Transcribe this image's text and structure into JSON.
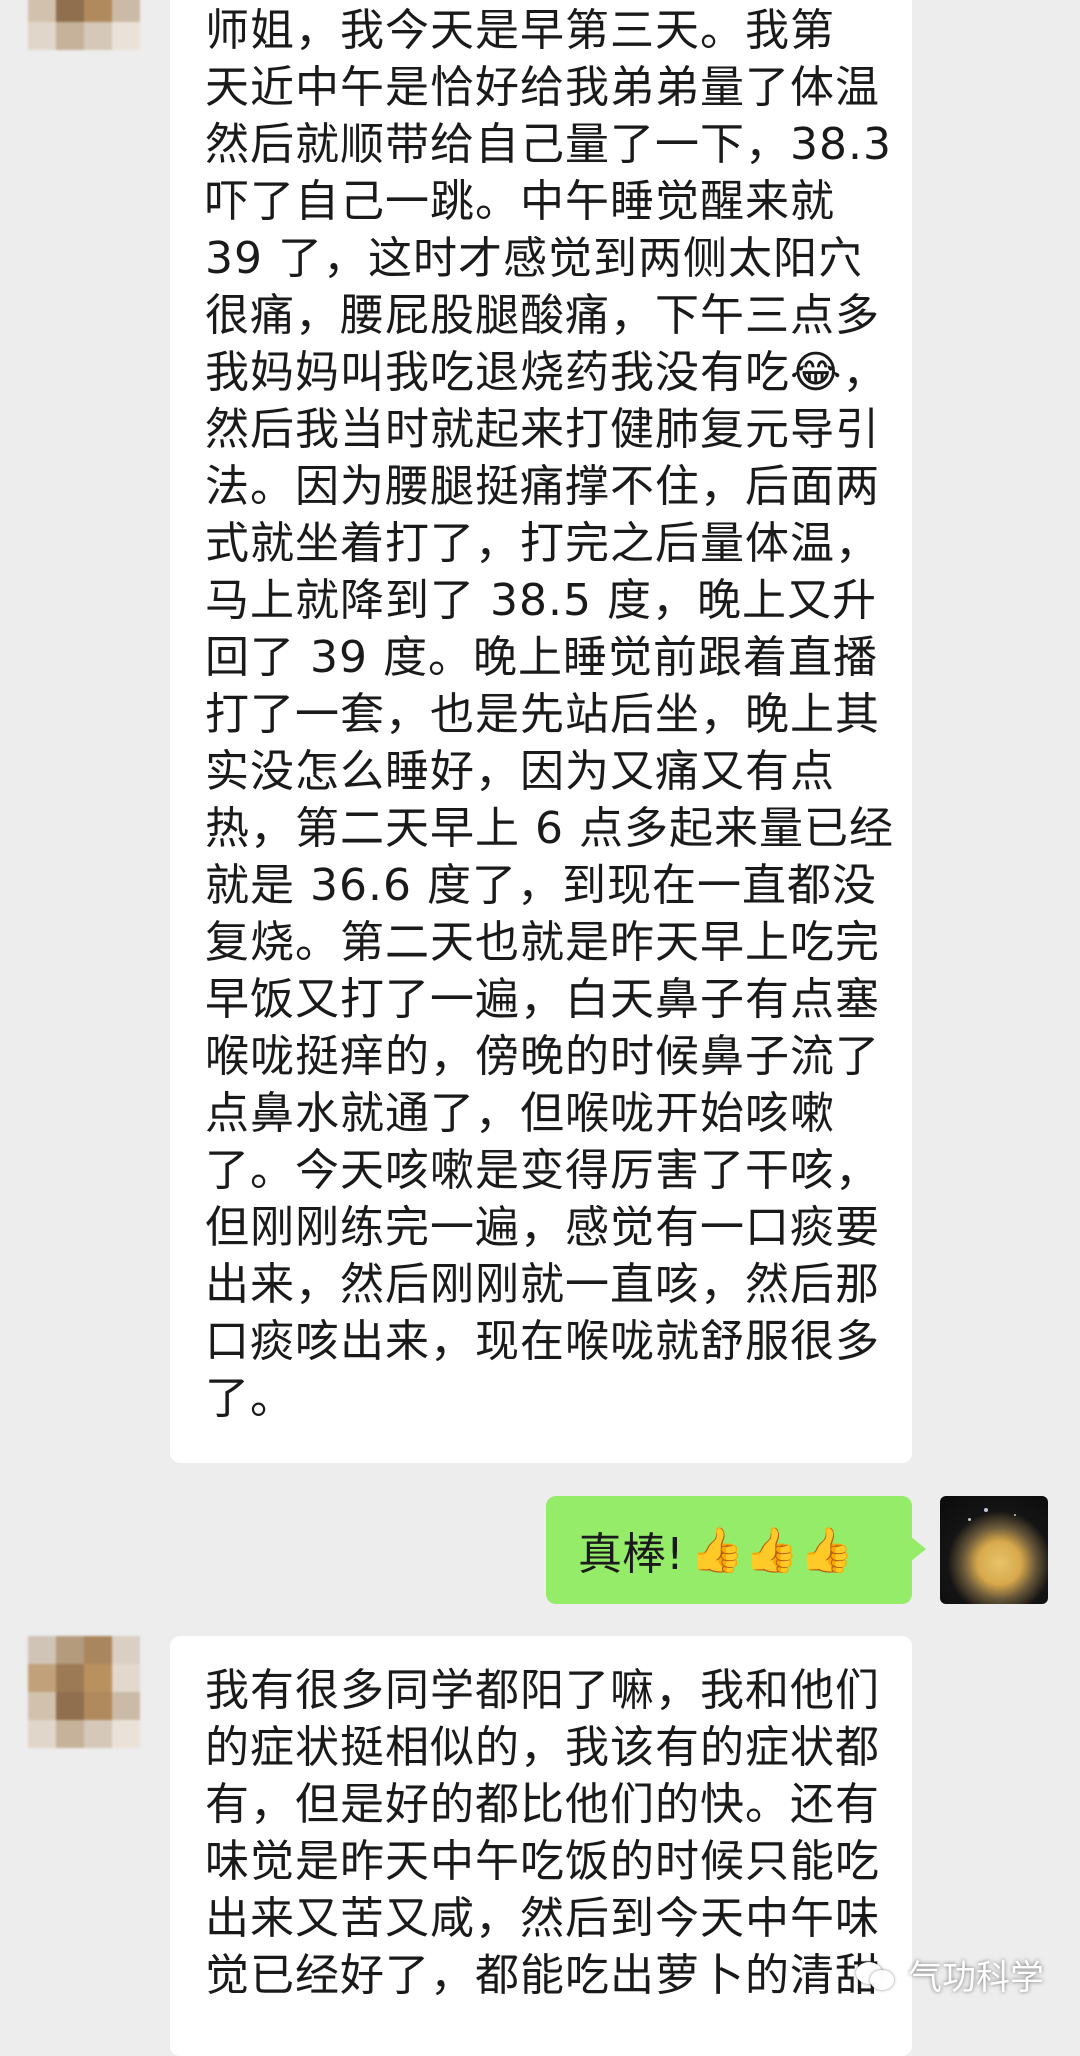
{
  "messages": [
    {
      "sender": "other",
      "lines": [
        "师姐，我今天是早第三天。我第",
        "天近中午是恰好给我弟弟量了体温",
        "然后就顺带给自己量了一下，38.3",
        "吓了自己一跳。中午睡觉醒来就",
        "39 了，这时才感觉到两侧太阳穴",
        "很痛，腰屁股腿酸痛，下午三点多",
        "我妈妈叫我吃退烧药我没有吃😂，",
        "然后我当时就起来打健肺复元导引",
        "法。因为腰腿挺痛撑不住，后面两",
        "式就坐着打了，打完之后量体温，",
        "马上就降到了 38.5 度，晚上又升",
        "回了 39 度。晚上睡觉前跟着直播",
        "打了一套，也是先站后坐，晚上其",
        "实没怎么睡好，因为又痛又有点",
        "热，第二天早上 6 点多起来量已经",
        "就是 36.6 度了，到现在一直都没",
        "复烧。第二天也就是昨天早上吃完",
        "早饭又打了一遍，白天鼻子有点塞",
        "喉咙挺痒的，傍晚的时候鼻子流了",
        "点鼻水就通了，但喉咙开始咳嗽",
        "了。今天咳嗽是变得厉害了干咳，",
        "但刚刚练完一遍，感觉有一口痰要",
        "出来，然后刚刚就一直咳，然后那",
        "口痰咳出来，现在喉咙就舒服很多",
        "了。"
      ]
    },
    {
      "sender": "self",
      "text": "真棒!",
      "emoji": "👍👍👍"
    },
    {
      "sender": "other",
      "lines": [
        "我有很多同学都阳了嘛，我和他们",
        "的症状挺相似的，我该有的症状都",
        "有，但是好的都比他们的快。还有",
        "味觉是昨天中午吃饭的时候只能吃",
        "出来又苦又咸，然后到今天中午味",
        "觉已经好了，都能吃出萝卜的清甜"
      ]
    }
  ],
  "watermark": {
    "icon": "wechat-icon",
    "text": "气功科学"
  },
  "colors": {
    "background": "#ededed",
    "bubble_other": "#ffffff",
    "bubble_self": "#95ec69"
  }
}
